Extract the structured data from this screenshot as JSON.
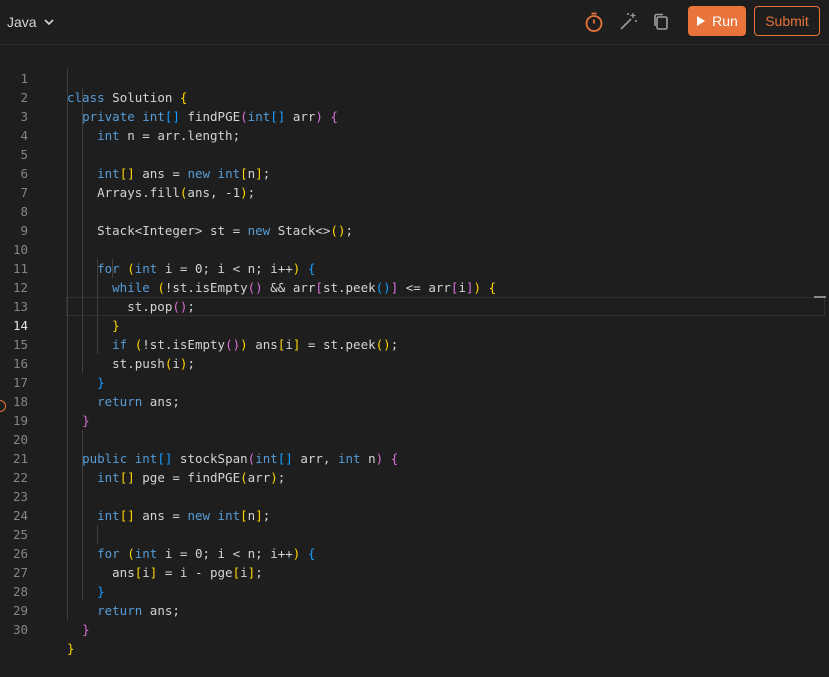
{
  "language": {
    "label": "Java"
  },
  "toolbar": {
    "run_label": "Run",
    "submit_label": "Submit",
    "icons": [
      "timer-icon",
      "magic-wand-icon",
      "copy-icon"
    ]
  },
  "colors": {
    "accent": "#e8743b",
    "keyword": "#569cd6",
    "text": "#d4d4d4"
  },
  "editor": {
    "active_line": 14,
    "lines": [
      "1",
      "2",
      "3",
      "4",
      "5",
      "6",
      "7",
      "8",
      "9",
      "10",
      "11",
      "12",
      "13",
      "14",
      "15",
      "16",
      "17",
      "18",
      "19",
      "20",
      "21",
      "22",
      "23",
      "24",
      "25",
      "26",
      "27",
      "28",
      "29",
      "30"
    ]
  }
}
